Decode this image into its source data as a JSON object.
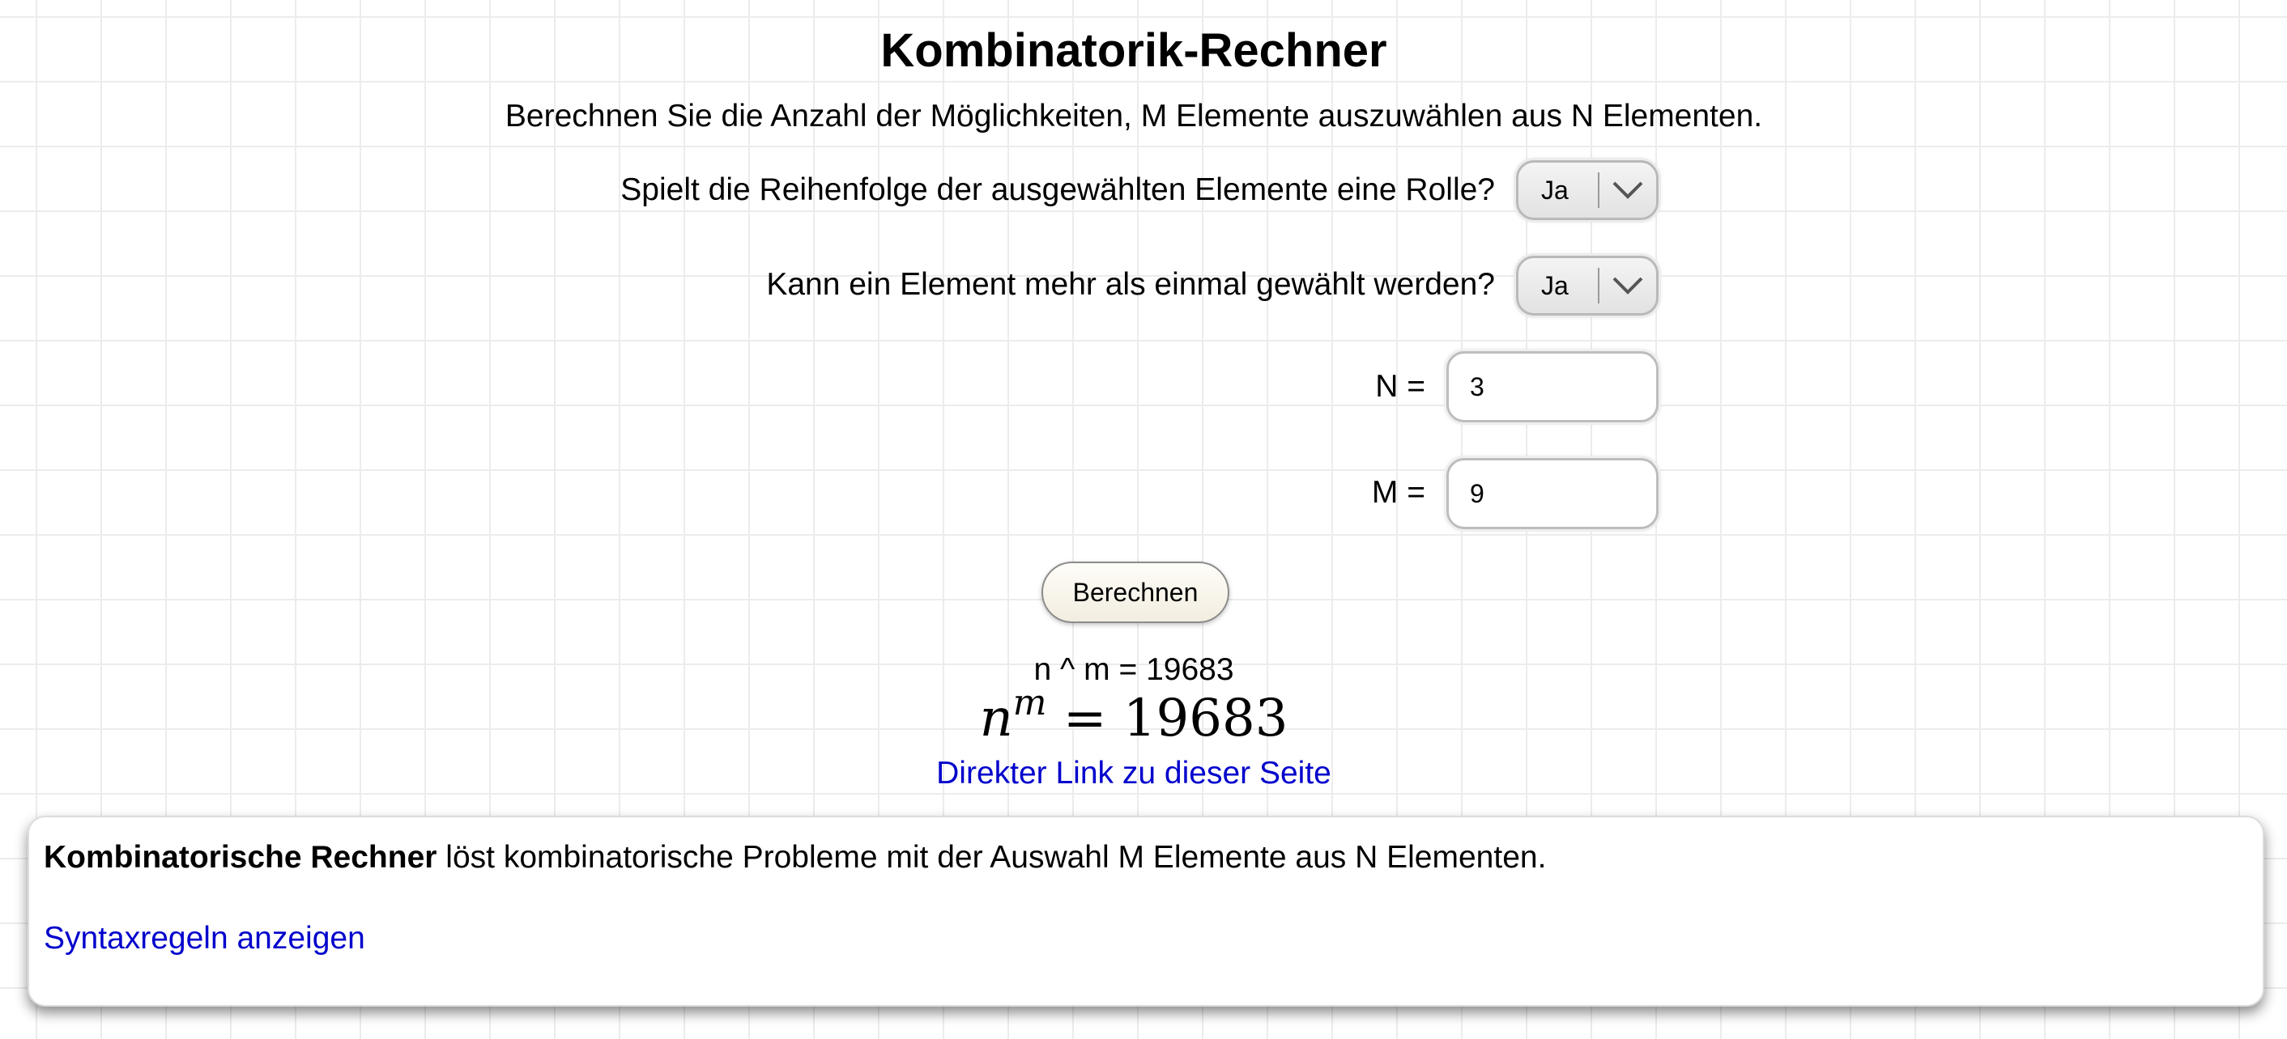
{
  "title": "Kombinatorik-Rechner",
  "subtitle": "Berechnen Sie die Anzahl der Möglichkeiten, M Elemente auszuwählen aus N Elementen.",
  "questions": [
    {
      "label": "Spielt die Reihenfolge der ausgewählten Elemente eine Rolle?",
      "selected": "Ja"
    },
    {
      "label": "Kann ein Element mehr als einmal gewählt werden?",
      "selected": "Ja"
    }
  ],
  "inputs": {
    "n": {
      "label": "N =",
      "value": "3"
    },
    "m": {
      "label": "M =",
      "value": "9"
    }
  },
  "calculate_button": "Berechnen",
  "result": {
    "text": "n ^ m = 19683",
    "formula_base": "n",
    "formula_exponent": "m",
    "formula_value": "= 19683"
  },
  "direct_link": "Direkter Link zu dieser Seite",
  "info": {
    "bold": "Kombinatorische Rechner",
    "text": " löst kombinatorische Probleme mit der Auswahl M Elemente aus N Elementen.",
    "syntax_link": "Syntaxregeln anzeigen"
  },
  "icons": {
    "dropdown": "chevron-down-icon"
  }
}
